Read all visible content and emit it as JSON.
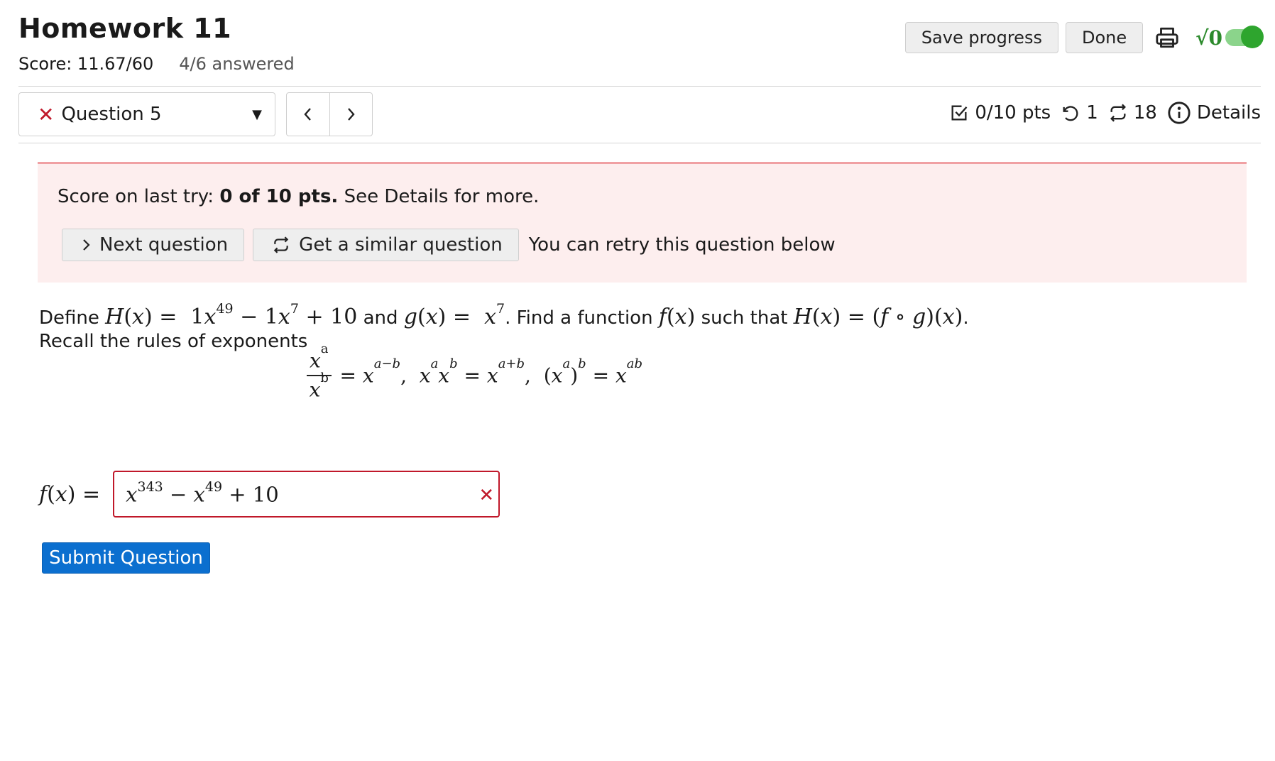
{
  "header": {
    "title": "Homework 11",
    "score": "Score: 11.67/60",
    "answered": "4/6 answered",
    "save_label": "Save progress",
    "done_label": "Done",
    "print_icon": "printer-icon",
    "math_toggle": {
      "label": "√0",
      "on": true,
      "color": "#2ea52e"
    }
  },
  "question_nav": {
    "current": "Question 5",
    "status_icon": "x-icon",
    "prev_icon": "chevron-left-icon",
    "next_icon": "chevron-right-icon"
  },
  "meta": {
    "points": "0/10 pts",
    "retries": "1",
    "versions": "18",
    "details": "Details"
  },
  "alert": {
    "text_prefix": "Score on last try:",
    "text_bold": "0 of 10 pts.",
    "text_suffix": "See Details for more.",
    "next_button": "Next question",
    "similar_button": "Get a similar question",
    "retry_text": "You can retry this question below",
    "background": "#fdeeee",
    "border": "#f0a0a3"
  },
  "question": {
    "define": "Define",
    "and": "and",
    "find": ". Find a function",
    "such_that": "such that",
    "period": ".",
    "recall": "Recall the rules of exponents"
  },
  "answer": {
    "label": "f(x) =",
    "value": "x^343 − x^49 + 10",
    "status": "incorrect"
  },
  "submit_label": "Submit Question",
  "colors": {
    "accent": "#0b6fcf",
    "error": "#c0182a",
    "toggle": "#2ea52e"
  }
}
